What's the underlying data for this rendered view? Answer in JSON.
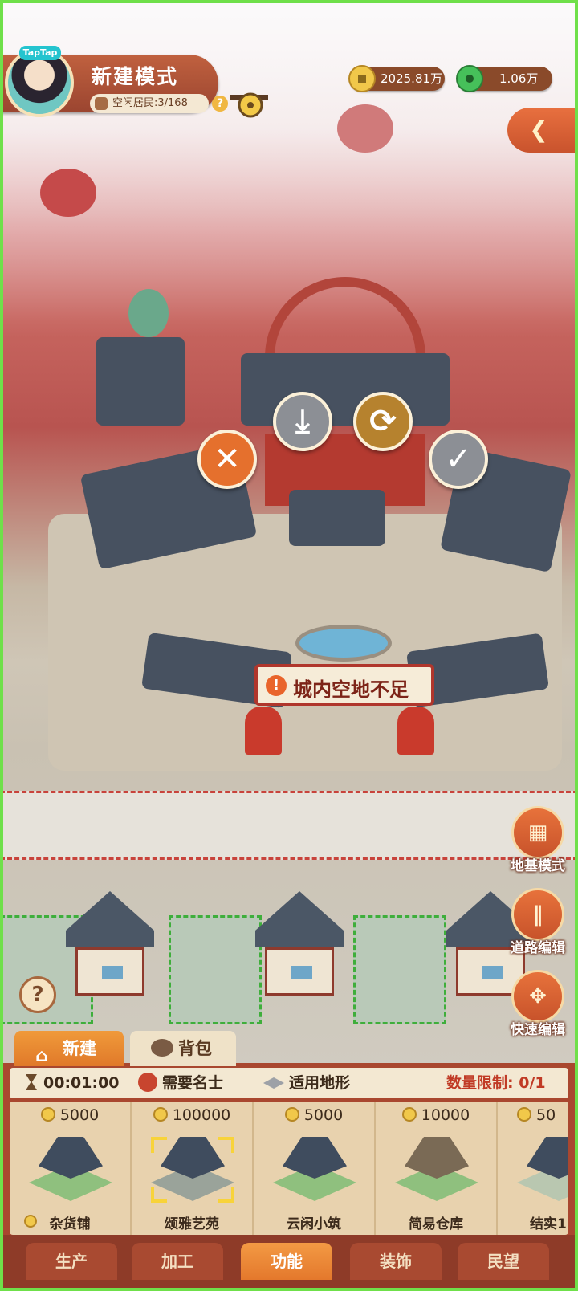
{
  "header": {
    "badge": "TapTap",
    "mode_title": "新建模式",
    "idle_residents": "空闲居民:3/168",
    "help": "?",
    "gold": "2025.81万",
    "jade": "1.06万"
  },
  "scene": {
    "warning": "城内空地不足",
    "warning_mark": "!"
  },
  "actions": {
    "cancel": "✕",
    "store": "⤓",
    "rotate": "⟳",
    "confirm": "✓"
  },
  "tools": [
    {
      "label": "地基模式",
      "glyph": "▦"
    },
    {
      "label": "道路编辑",
      "glyph": "‖"
    },
    {
      "label": "快速编辑",
      "glyph": "✥"
    }
  ],
  "panel": {
    "tab_new": "新建",
    "tab_bag": "背包",
    "time": "00:01:00",
    "requirement": "需要名士",
    "terrain": "适用地形",
    "limit": "数量限制: 0/1",
    "cards": [
      {
        "price": "5000",
        "name": "杂货铺"
      },
      {
        "price": "100000",
        "name": "颂雅艺苑"
      },
      {
        "price": "5000",
        "name": "云闲小筑"
      },
      {
        "price": "10000",
        "name": "简易仓库"
      },
      {
        "price": "50",
        "name": "结实1"
      }
    ]
  },
  "bottom_tabs": [
    "生产",
    "加工",
    "功能",
    "装饰",
    "民望"
  ],
  "active_bottom_tab": "功能",
  "help_big": "?"
}
